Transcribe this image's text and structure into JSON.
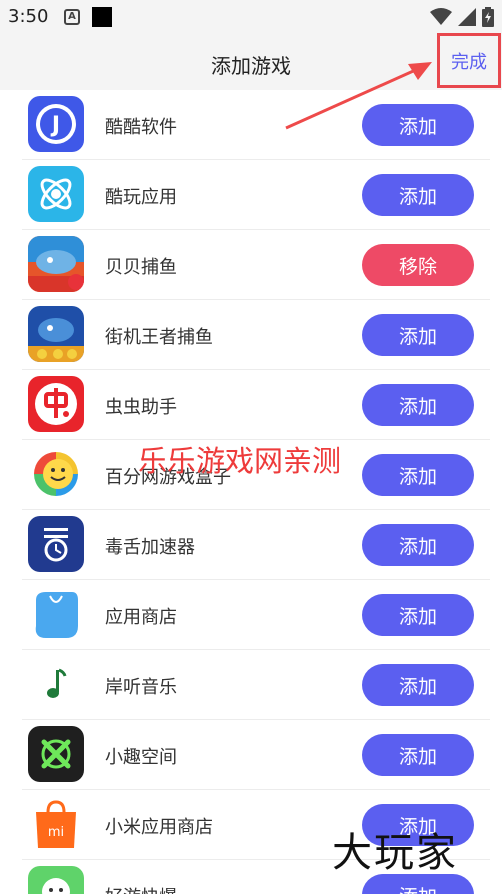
{
  "status_bar": {
    "time": "3:50",
    "notification_letter": "A"
  },
  "header": {
    "title": "添加游戏",
    "done_label": "完成"
  },
  "watermark": "乐乐游戏网亲测",
  "logo_mark": "大玩家",
  "apps": [
    {
      "name": "酷酷软件",
      "action": "添加",
      "icon": "j-blue-icon"
    },
    {
      "name": "酷玩应用",
      "action": "添加",
      "icon": "atom-icon"
    },
    {
      "name": "贝贝捕鱼",
      "action": "移除",
      "icon": "shark-game-icon"
    },
    {
      "name": "街机王者捕鱼",
      "action": "添加",
      "icon": "fish-game-icon"
    },
    {
      "name": "虫虫助手",
      "action": "添加",
      "icon": "chong-icon"
    },
    {
      "name": "百分网游戏盒子",
      "action": "添加",
      "icon": "smile-ring-icon"
    },
    {
      "name": "毒舌加速器",
      "action": "添加",
      "icon": "accelerator-icon"
    },
    {
      "name": "应用商店",
      "action": "添加",
      "icon": "store-bag-icon"
    },
    {
      "name": "岸听音乐",
      "action": "添加",
      "icon": "music-note-icon"
    },
    {
      "name": "小趣空间",
      "action": "添加",
      "icon": "x-space-icon"
    },
    {
      "name": "小米应用商店",
      "action": "添加",
      "icon": "mi-store-icon"
    },
    {
      "name": "好游快爆",
      "action": "添加",
      "icon": "haoyou-icon"
    }
  ],
  "colors": {
    "primary": "#5b5ff0",
    "remove": "#ee4a66",
    "highlight": "#e8474d"
  }
}
